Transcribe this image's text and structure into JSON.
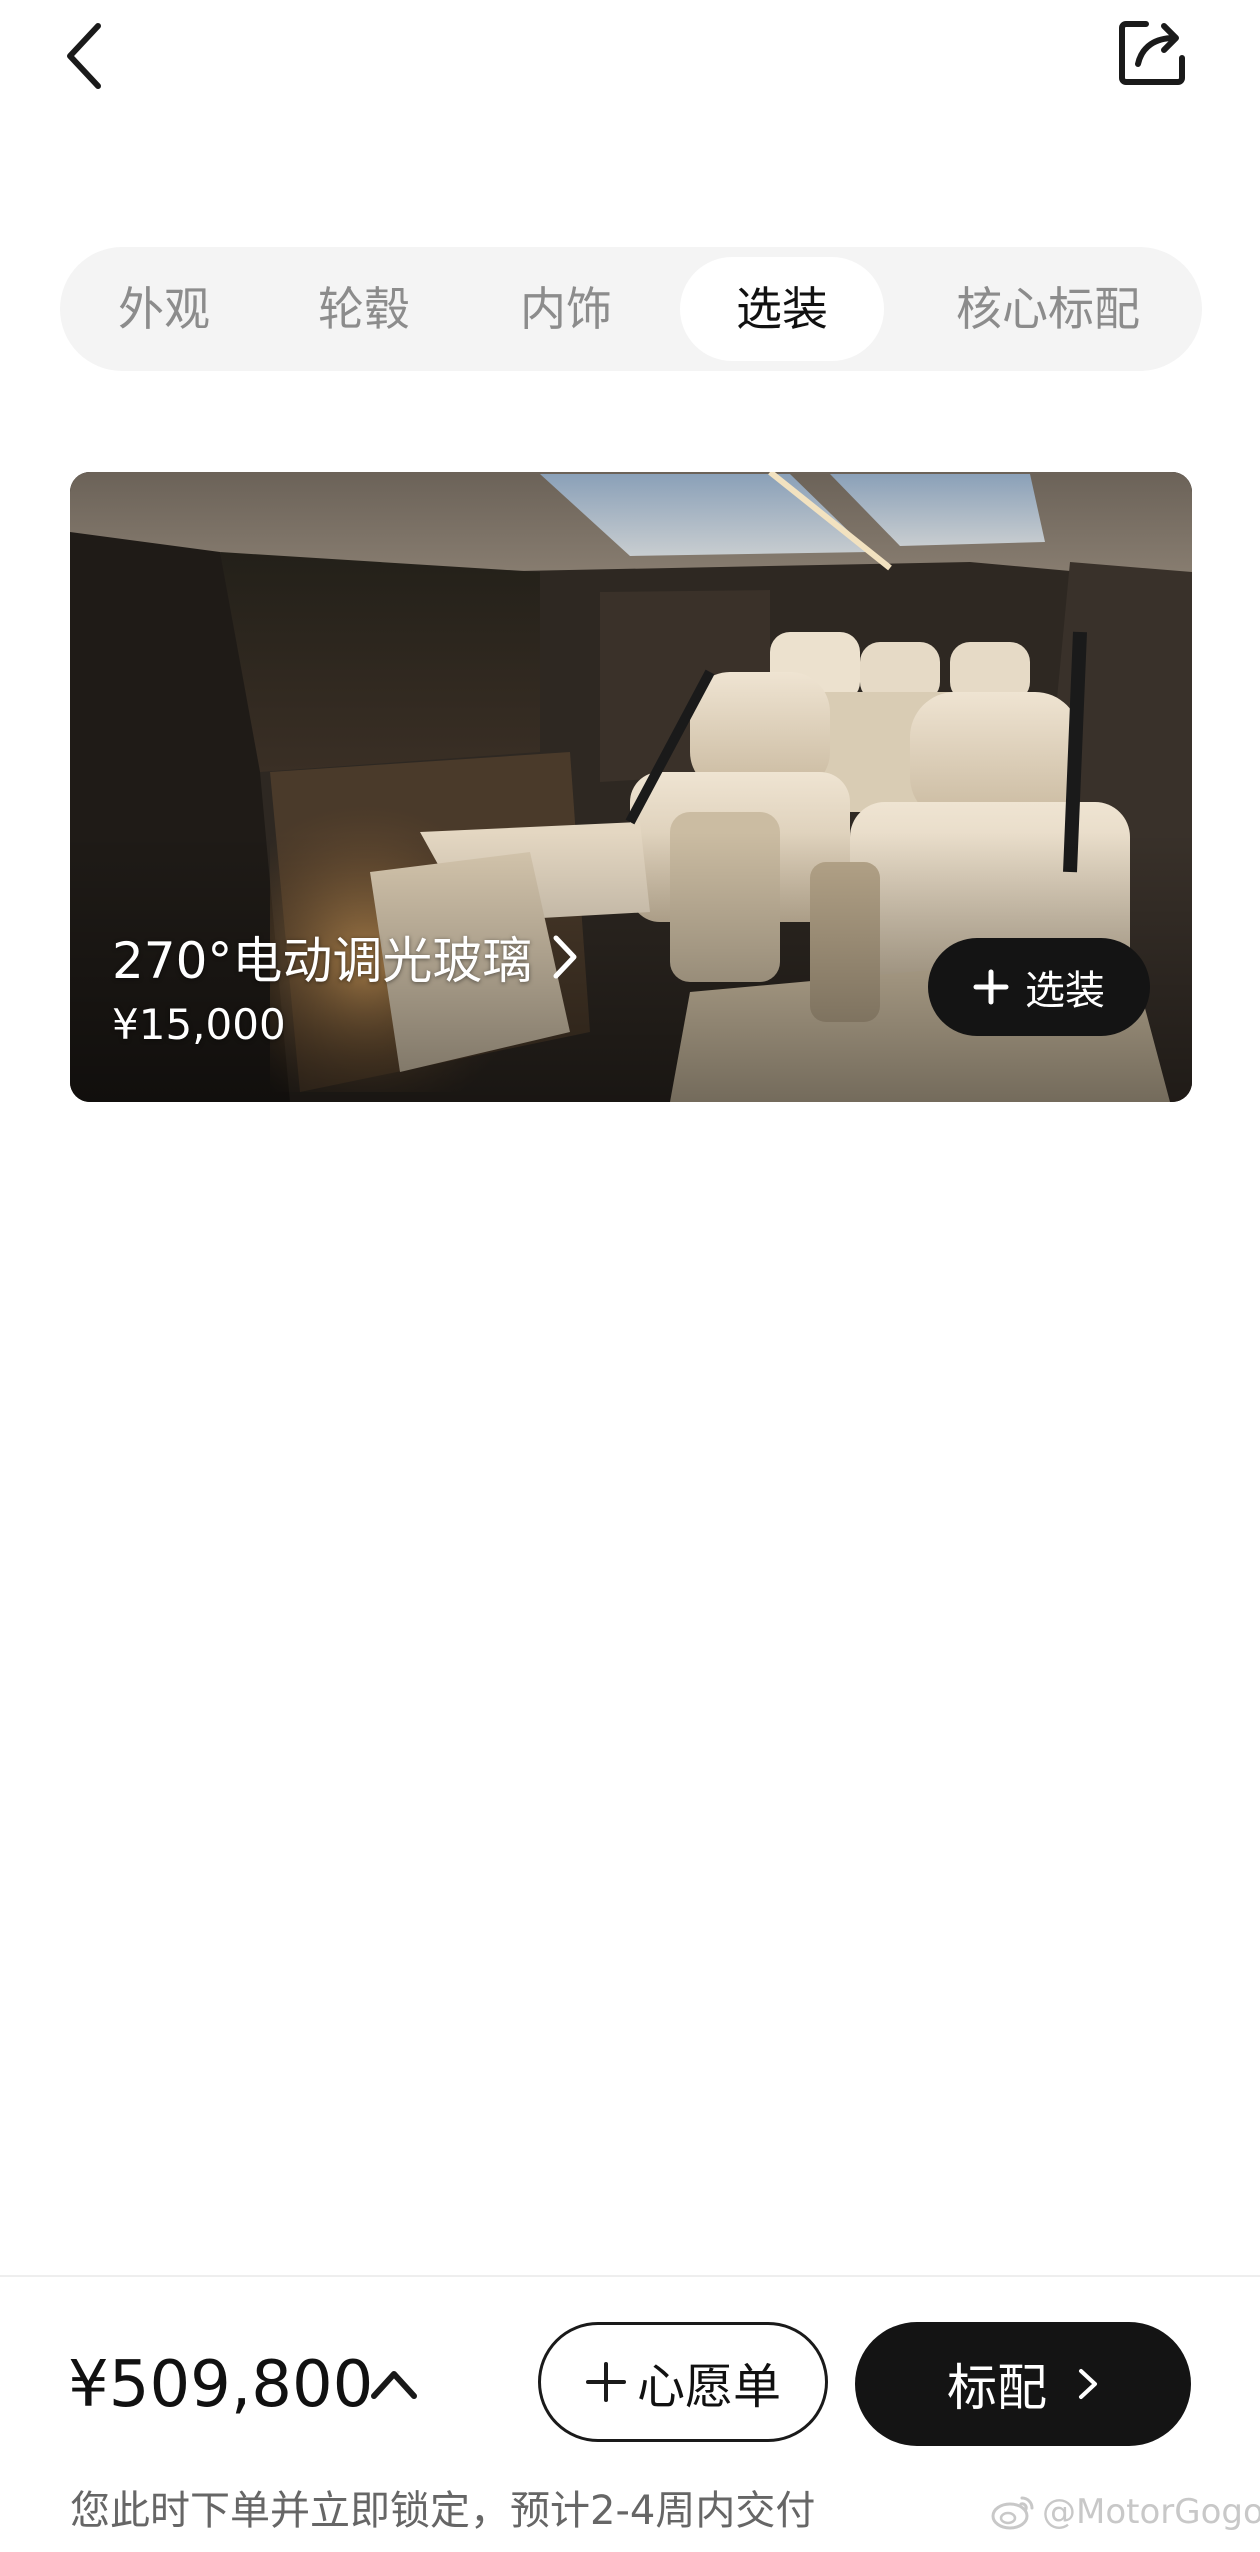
{
  "header": {
    "back_icon": "chevron-left-icon",
    "share_icon": "share-icon"
  },
  "tabs": [
    {
      "label": "外观",
      "active": false
    },
    {
      "label": "轮毂",
      "active": false
    },
    {
      "label": "内饰",
      "active": false
    },
    {
      "label": "选装",
      "active": true
    },
    {
      "label": "核心标配",
      "active": false
    }
  ],
  "option_card": {
    "image": "car-interior-seats-photo",
    "title": "270°电动调光玻璃",
    "price": "¥15,000",
    "add_button_label": "选装"
  },
  "footer": {
    "total_price": "¥509,800",
    "wishlist_label": "心愿单",
    "config_label": "标配",
    "delivery_note": "您此时下单并立即锁定，预计2-4周内交付"
  },
  "watermark": {
    "text": "@MotorGogo"
  },
  "colors": {
    "accent": "#141414",
    "tab_bg": "#f4f4f4",
    "muted_text": "#8c8c8c"
  }
}
